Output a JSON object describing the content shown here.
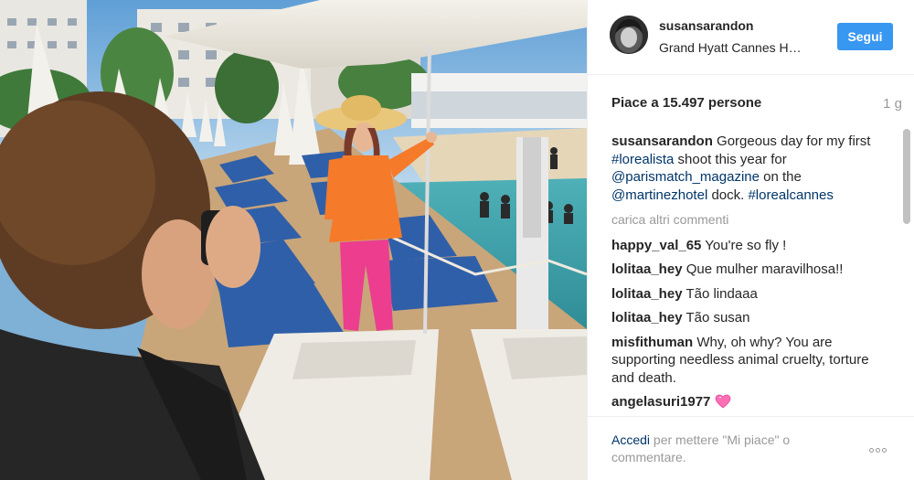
{
  "post": {
    "username": "susansarandon",
    "location": "Grand Hyatt Cannes H…",
    "follow_label": "Segui",
    "likes": "Piace a 15.497 persone",
    "time": "1 g"
  },
  "caption": {
    "user": "susansarandon",
    "t1": " Gorgeous day for my first ",
    "tag1": "#lorealista",
    "t2": " shoot this year for ",
    "mention1": "@parismatch_magazine",
    "t3": " on the ",
    "mention2": "@martinezhotel",
    "t4": " dock. ",
    "tag2": "#lorealcannes"
  },
  "load_more": "carica altri commenti",
  "comments": [
    {
      "user": "happy_val_65",
      "text": " You're so fly !"
    },
    {
      "user": "lolitaa_hey",
      "text": " Que mulher maravilhosa!!"
    },
    {
      "user": "lolitaa_hey",
      "text": " Tão lindaaa"
    },
    {
      "user": "lolitaa_hey",
      "text": " Tão susan"
    },
    {
      "user": "misfithuman",
      "text": " Why, oh why? You are supporting needless animal cruelty, torture and death."
    },
    {
      "user": "angelasuri1977",
      "text": " "
    }
  ],
  "footer": {
    "login": "Accedi",
    "text": " per mettere \"Mi piace\" o commentare."
  },
  "colors": {
    "follow": "#3897f0",
    "link": "#003569",
    "muted": "#999999",
    "heart": "#ff6fb5"
  },
  "icons": [
    "heart-emoji-icon",
    "more-options-icon"
  ]
}
